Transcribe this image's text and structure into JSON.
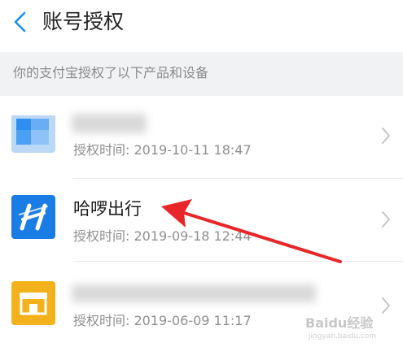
{
  "header": {
    "title": "账号授权"
  },
  "section": {
    "label": "你的支付宝授权了以下产品和设备"
  },
  "rows": [
    {
      "name": "",
      "time": "授权时间: 2019-10-11 18:47"
    },
    {
      "name": "哈啰出行",
      "time": "授权时间: 2019-09-18 12:44"
    },
    {
      "name": "",
      "time": "授权时间: 2019-06-09 11:17"
    }
  ],
  "watermark": {
    "brand": "Baidu经验",
    "url": "jingyan.baidu.com"
  },
  "colors": {
    "accent": "#1b8ff0",
    "hellobike": "#1a7de6",
    "store": "#f3b21c",
    "annotation": "#e8262a"
  }
}
